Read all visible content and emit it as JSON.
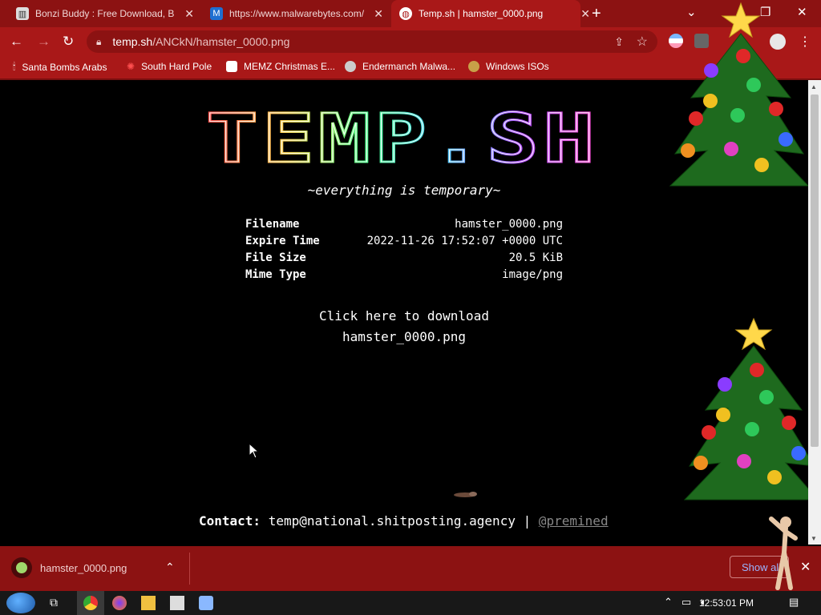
{
  "browser": {
    "tabs": [
      {
        "title": "Bonzi Buddy : Free Download, B",
        "active": false
      },
      {
        "title": "https://www.malwarebytes.com/",
        "active": false
      },
      {
        "title": "Temp.sh | hamster_0000.png",
        "active": true
      }
    ],
    "url_host": "temp.sh",
    "url_path": "/ANCkN/hamster_0000.png",
    "bookmarks": [
      {
        "label": "Santa Bombs Arabs",
        "icon": "bomb-icon"
      },
      {
        "label": "South Hard Pole",
        "icon": "virus-icon"
      },
      {
        "label": "MEMZ Christmas E...",
        "icon": "memz-icon"
      },
      {
        "label": "Endermanch Malwa...",
        "icon": "raccoon-icon"
      },
      {
        "label": "Windows ISOs",
        "icon": "buddha-icon"
      }
    ]
  },
  "page": {
    "logo_text": "TEMP.SH",
    "tagline": "~everything is temporary~",
    "info": [
      {
        "key": "Filename",
        "value": "hamster_0000.png"
      },
      {
        "key": "Expire Time",
        "value": "2022-11-26 17:52:07 +0000 UTC"
      },
      {
        "key": "File Size",
        "value": "20.5 KiB"
      },
      {
        "key": "Mime Type",
        "value": "image/png"
      }
    ],
    "download_line1": "Click here to download",
    "download_line2": "hamster_0000.png",
    "contact_label": "Contact:",
    "contact_email": "temp@national.shitposting.agency",
    "contact_sep": "|",
    "contact_handle": "@premined"
  },
  "downloads": {
    "item": "hamster_0000.png",
    "show_all": "Show all"
  },
  "taskbar": {
    "clock": "12:53:01 PM"
  },
  "colors": {
    "chrome_dark": "#8c1212",
    "chrome": "#a91818",
    "page_bg": "#000000"
  }
}
